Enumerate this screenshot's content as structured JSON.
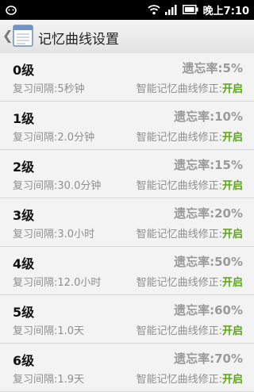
{
  "status_bar": {
    "time": "晚上7:10",
    "icons": [
      "notification-icon",
      "wifi-icon",
      "signal-icon",
      "battery-icon"
    ]
  },
  "header": {
    "title": "记忆曲线设置",
    "back_icon": "chevron-left-icon",
    "app_icon": "notes-app-icon"
  },
  "items": [
    {
      "level": "0级",
      "forget_label": "遗忘率:",
      "forget_value": "5%",
      "interval_label": "复习间隔:",
      "interval_value": "5秒钟",
      "correction_label": "智能记忆曲线修正:",
      "correction_value": "开启"
    },
    {
      "level": "1级",
      "forget_label": "遗忘率:",
      "forget_value": "10%",
      "interval_label": "复习间隔:",
      "interval_value": "2.0分钟",
      "correction_label": "智能记忆曲线修正:",
      "correction_value": "开启"
    },
    {
      "level": "2级",
      "forget_label": "遗忘率:",
      "forget_value": "15%",
      "interval_label": "复习间隔:",
      "interval_value": "30.0分钟",
      "correction_label": "智能记忆曲线修正:",
      "correction_value": "开启"
    },
    {
      "level": "3级",
      "forget_label": "遗忘率:",
      "forget_value": "20%",
      "interval_label": "复习间隔:",
      "interval_value": "3.0小时",
      "correction_label": "智能记忆曲线修正:",
      "correction_value": "开启"
    },
    {
      "level": "4级",
      "forget_label": "遗忘率:",
      "forget_value": "50%",
      "interval_label": "复习间隔:",
      "interval_value": "12.0小时",
      "correction_label": "智能记忆曲线修正:",
      "correction_value": "开启"
    },
    {
      "level": "5级",
      "forget_label": "遗忘率:",
      "forget_value": "60%",
      "interval_label": "复习间隔:",
      "interval_value": "1.0天",
      "correction_label": "智能记忆曲线修正:",
      "correction_value": "开启"
    },
    {
      "level": "6级",
      "forget_label": "遗忘率:",
      "forget_value": "70%",
      "interval_label": "复习间隔:",
      "interval_value": "1.9天",
      "correction_label": "智能记忆曲线修正:",
      "correction_value": "开启"
    }
  ],
  "colors": {
    "accent_on": "#5aa514",
    "status_bar": "#000000"
  }
}
